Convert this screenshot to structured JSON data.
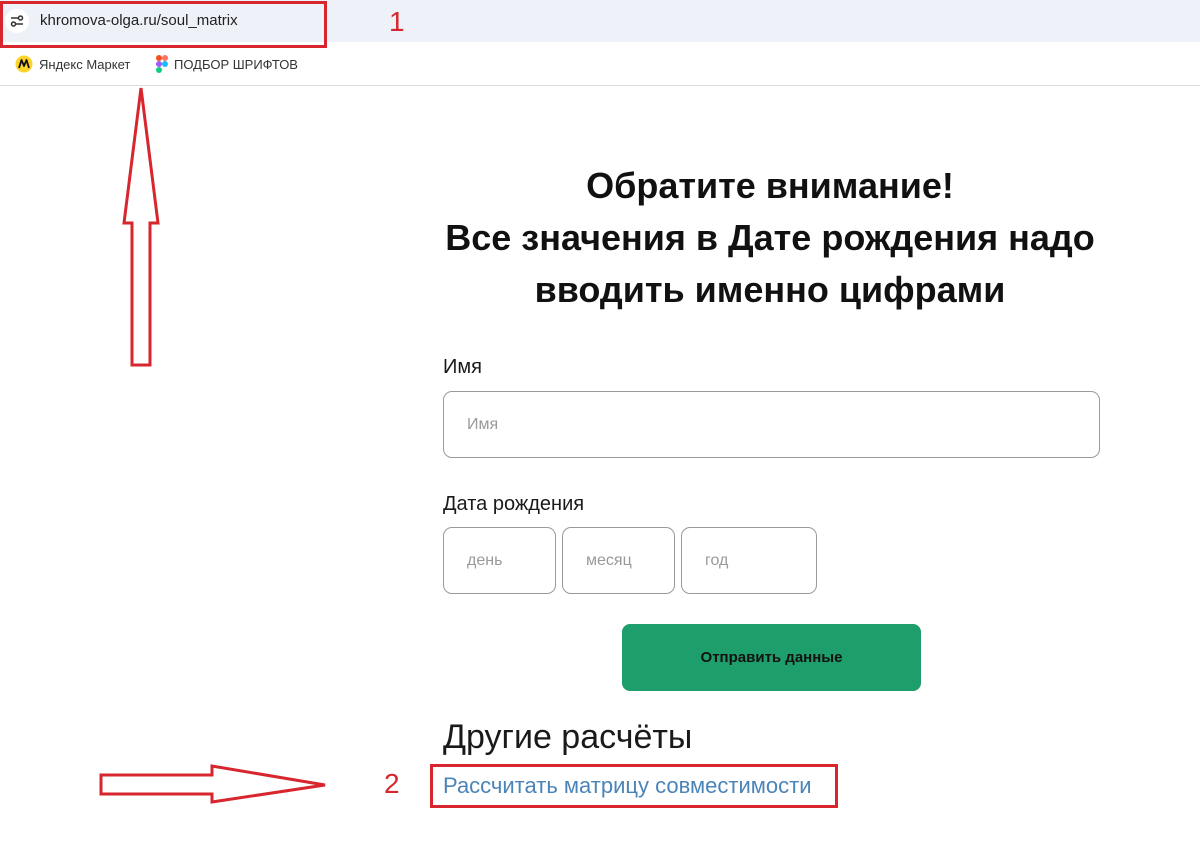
{
  "browser": {
    "url": "khromova-olga.ru/soul_matrix",
    "bookmarks": [
      {
        "label": "Яндекс Маркет",
        "icon": "yandex-market-icon"
      },
      {
        "label": "ПОДБОР ШРИФТОВ",
        "icon": "figma-icon"
      }
    ]
  },
  "annotations": {
    "marker_1": "1",
    "marker_2": "2",
    "color": "#d7262d"
  },
  "main": {
    "headline_lines": [
      "Обратите внимание!",
      "Все значения в Дате рождения надо",
      "вводить именно цифрами"
    ],
    "name_label": "Имя",
    "name_placeholder": "Имя",
    "birthdate_label": "Дата рождения",
    "day_placeholder": "день",
    "month_placeholder": "месяц",
    "year_placeholder": "год",
    "submit_label": "Отправить данные",
    "other_title": "Другие расчёты",
    "compat_link": "Рассчитать матрицу совместимости"
  },
  "colors": {
    "button": "#1e9e6a",
    "link": "#4a84b8",
    "annotation": "#d7262d"
  }
}
